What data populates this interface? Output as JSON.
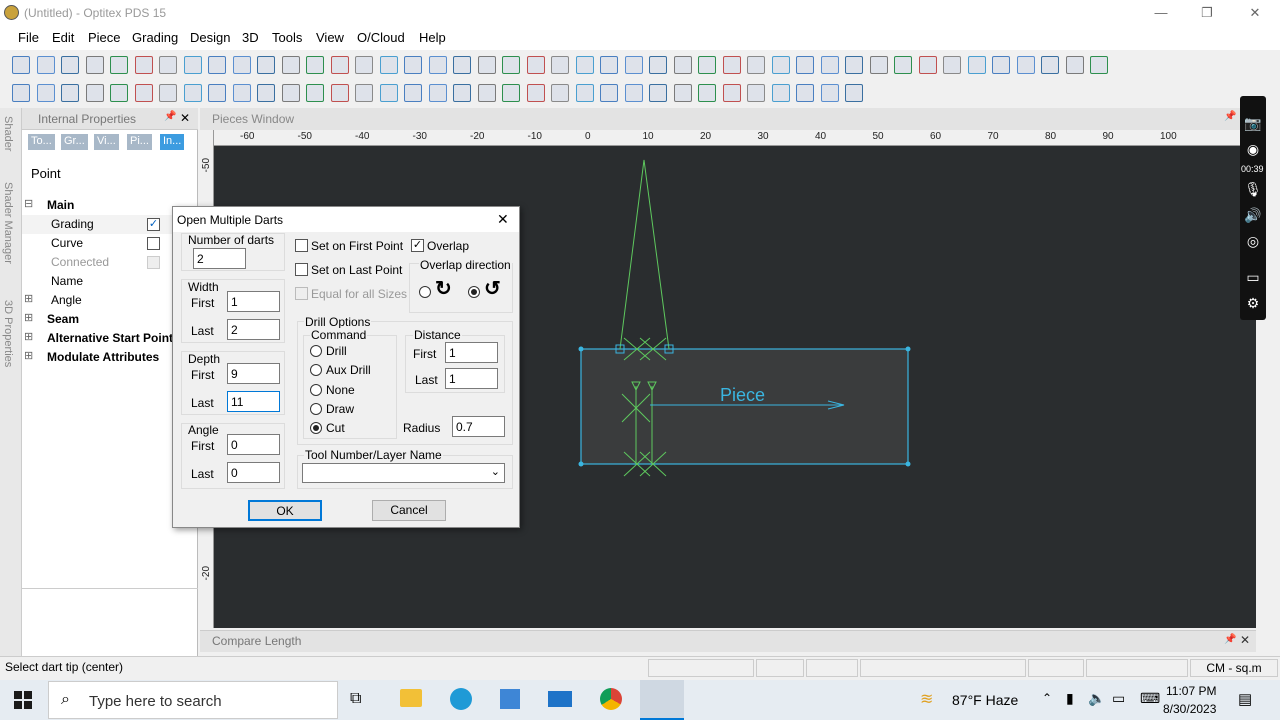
{
  "window": {
    "title": "(Untitled) - Optitex PDS 15",
    "min": "—",
    "max": "❐",
    "close": "✕"
  },
  "menu": [
    "File",
    "Edit",
    "Piece",
    "Grading",
    "Design",
    "3D",
    "Tools",
    "View",
    "O/Cloud",
    "Help"
  ],
  "side_tabs": [
    "Shader",
    "Shader Manager",
    "3D Properties"
  ],
  "props": {
    "title": "Internal Properties",
    "pin": "📌",
    "close": "✕",
    "tabs": [
      "To...",
      "Gr...",
      "Vi...",
      "Pi...",
      "In..."
    ],
    "heading": "Point",
    "rows": [
      {
        "label": "Main",
        "bold": true,
        "expander": "⊟"
      },
      {
        "label": "Grading",
        "checked": true
      },
      {
        "label": "Curve",
        "checked": false
      },
      {
        "label": "Connected",
        "disabled": true
      },
      {
        "label": "Name"
      },
      {
        "label": "Angle",
        "expander": "⊞"
      },
      {
        "label": "Seam",
        "bold": true,
        "expander": "⊞"
      },
      {
        "label": "Alternative Start Point",
        "bold": true,
        "expander": "⊞"
      },
      {
        "label": "Modulate Attributes",
        "bold": true,
        "expander": "⊞"
      }
    ]
  },
  "pieces": {
    "title": "Pieces Window",
    "pin": "📌",
    "close": "✕",
    "ruler_h": [
      "-60",
      "-50",
      "-40",
      "-30",
      "-20",
      "-10",
      "0",
      "10",
      "20",
      "30",
      "40",
      "50",
      "60",
      "70",
      "80",
      "90",
      "100"
    ],
    "ruler_v": [
      "-50",
      "-20"
    ],
    "piece_label": "Piece"
  },
  "compare": {
    "title": "Compare Length",
    "pin": "📌",
    "close": "✕"
  },
  "status": {
    "text": "Select dart tip (center)",
    "units": "CM - sq.m"
  },
  "recorder": {
    "time": "00:39"
  },
  "dialog": {
    "title": "Open Multiple Darts",
    "close": "✕",
    "num_darts_label": "Number of darts",
    "num_darts": "2",
    "width_label": "Width",
    "first": "First",
    "last": "Last",
    "width_first": "1",
    "width_last": "2",
    "depth_label": "Depth",
    "depth_first": "9",
    "depth_last": "11",
    "angle_label": "Angle",
    "angle_first": "0",
    "angle_last": "0",
    "set_first": "Set on First Point",
    "set_last": "Set on Last Point",
    "equal_sizes": "Equal for all Sizes",
    "overlap": "Overlap",
    "overlap_dir": "Overlap direction",
    "drill_options": "Drill Options",
    "command": "Command",
    "commands": [
      "Drill",
      "Aux Drill",
      "None",
      "Draw",
      "Cut"
    ],
    "selected_command": "Cut",
    "distance": "Distance",
    "dist_first": "1",
    "dist_last": "1",
    "radius_label": "Radius",
    "radius": "0.7",
    "tool_label": "Tool Number/Layer Name",
    "tool_value": "",
    "ok": "OK",
    "cancel": "Cancel"
  },
  "taskbar": {
    "search_placeholder": "Type here to search",
    "weather": "87°F  Haze",
    "time": "11:07 PM",
    "date": "8/30/2023"
  },
  "colors": {
    "accent": "#0078d7",
    "piece": "#3ab5e0",
    "dart": "#5ec85e",
    "canvas": "#2a2d2f"
  }
}
